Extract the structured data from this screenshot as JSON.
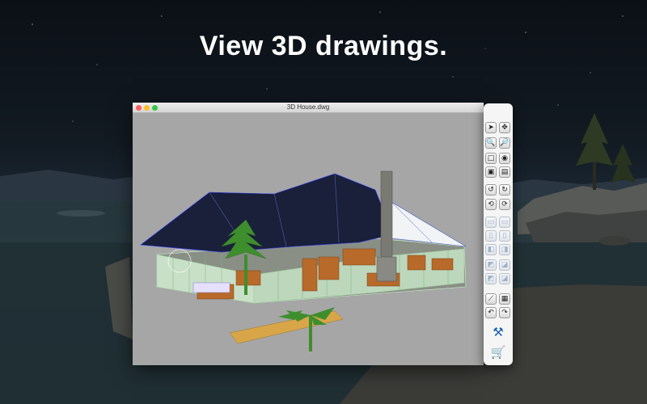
{
  "headline": "View 3D drawings.",
  "window": {
    "title": "3D House.dwg"
  },
  "palette": {
    "tools": [
      "select-arrow-icon",
      "move-icon",
      "zoom-in-icon",
      "zoom-out-icon",
      "rectangle-icon",
      "eye-icon",
      "view-box-icon",
      "print-icon",
      "rotate-left-icon",
      "rotate-right-icon",
      "orbit-360-icon",
      "orbit-reset-icon",
      "view-top-icon",
      "view-bottom-icon",
      "view-front-icon",
      "view-back-icon",
      "view-left-icon",
      "view-right-icon",
      "view-iso-sw-icon",
      "view-iso-se-icon",
      "view-iso-nw-icon",
      "view-iso-ne-icon",
      "measure-icon",
      "layers-icon",
      "undo-icon",
      "redo-icon",
      "tools-icon",
      "cart-icon"
    ]
  },
  "colors": {
    "viewport": "#a6a6a6",
    "roof": "#1a1f3a",
    "wood": "#b86a2a",
    "tree": "#3e8e2e",
    "wireframe": "#c8f5c8"
  }
}
